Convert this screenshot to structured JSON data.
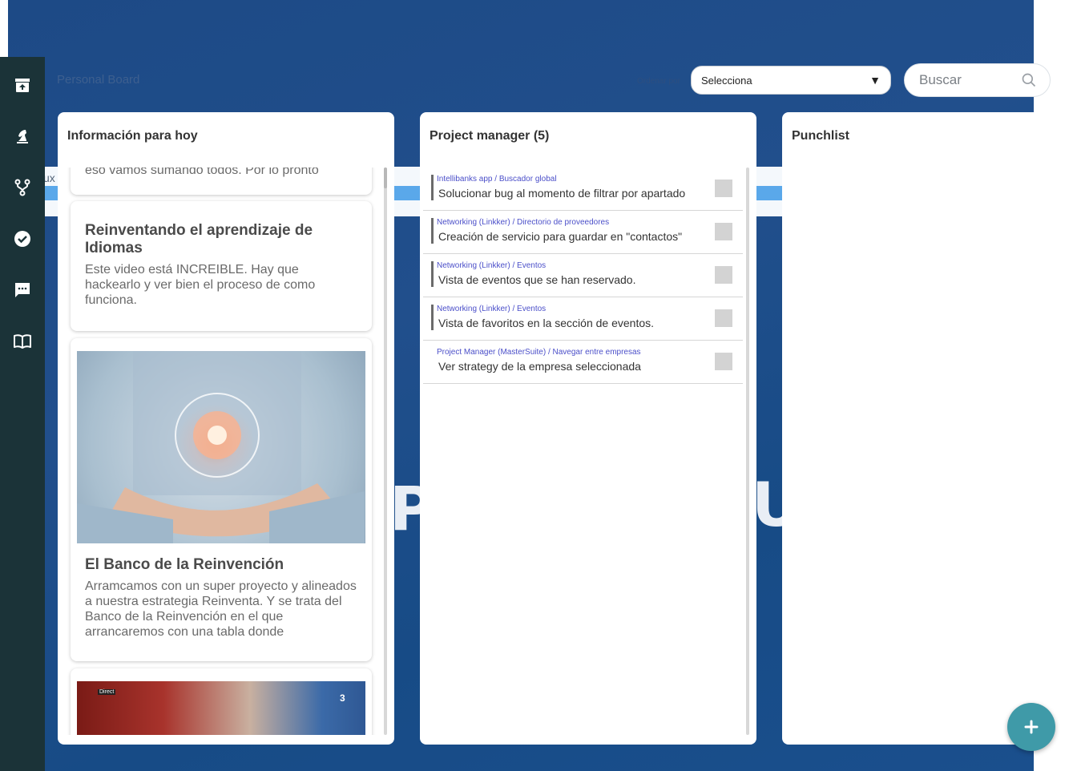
{
  "header": {
    "title": "Personal Board",
    "filter_label": "Ordenar por",
    "select_value": "Selecciona",
    "search_placeholder": "Buscar"
  },
  "sidebar": {
    "items": [
      {
        "icon": "archive-icon"
      },
      {
        "icon": "chess-knight-icon"
      },
      {
        "icon": "fork-icon"
      },
      {
        "icon": "check-circle-icon"
      },
      {
        "icon": "chat-icon"
      },
      {
        "icon": "book-icon"
      }
    ]
  },
  "background": {
    "ghost_text": "ux",
    "letter_left": "P",
    "letter_right": "U"
  },
  "columns": {
    "info": {
      "title": "Información para hoy",
      "cards": [
        {
          "body": "eso vamos sumando todos. Por lo pronto"
        },
        {
          "title": "Reinventando el aprendizaje de Idiomas",
          "body": "Este video está INCREIBLE. Hay que hackearlo y ver bien el proceso de como funciona."
        },
        {
          "title": "El Banco de la Reinvención",
          "body": "Arramcamos con un super proyecto y alineados a nuestra estrategia Reinventa. Y se trata del Banco de la Reinvención en el que arrancaremos con una tabla donde"
        },
        {
          "image_badge": "Direct",
          "image_number": "3"
        }
      ]
    },
    "pm": {
      "title": "Project manager (5)",
      "tasks": [
        {
          "crumb": "Intellibanks app / Buscador global",
          "name": "Solucionar bug al momento de filtrar por apartado"
        },
        {
          "crumb": "Networking (Linkker) / Directorio de proveedores",
          "name": "Creación de servicio para guardar en \"contactos\""
        },
        {
          "crumb": "Networking (Linkker) / Eventos",
          "name": "Vista de eventos que se han reservado."
        },
        {
          "crumb": "Networking (Linkker) / Eventos",
          "name": "Vista de favoritos en la sección de eventos."
        },
        {
          "crumb": "Project Manager (MasterSuite) / Navegar entre empresas",
          "name": "Ver strategy de la empresa seleccionada"
        }
      ]
    },
    "punch": {
      "title": "Punchlist"
    }
  },
  "colors": {
    "sidebar": "#1b3338",
    "background": "#1d4a86",
    "fab": "#3f9aa8",
    "crumb": "#4b4fc9"
  }
}
